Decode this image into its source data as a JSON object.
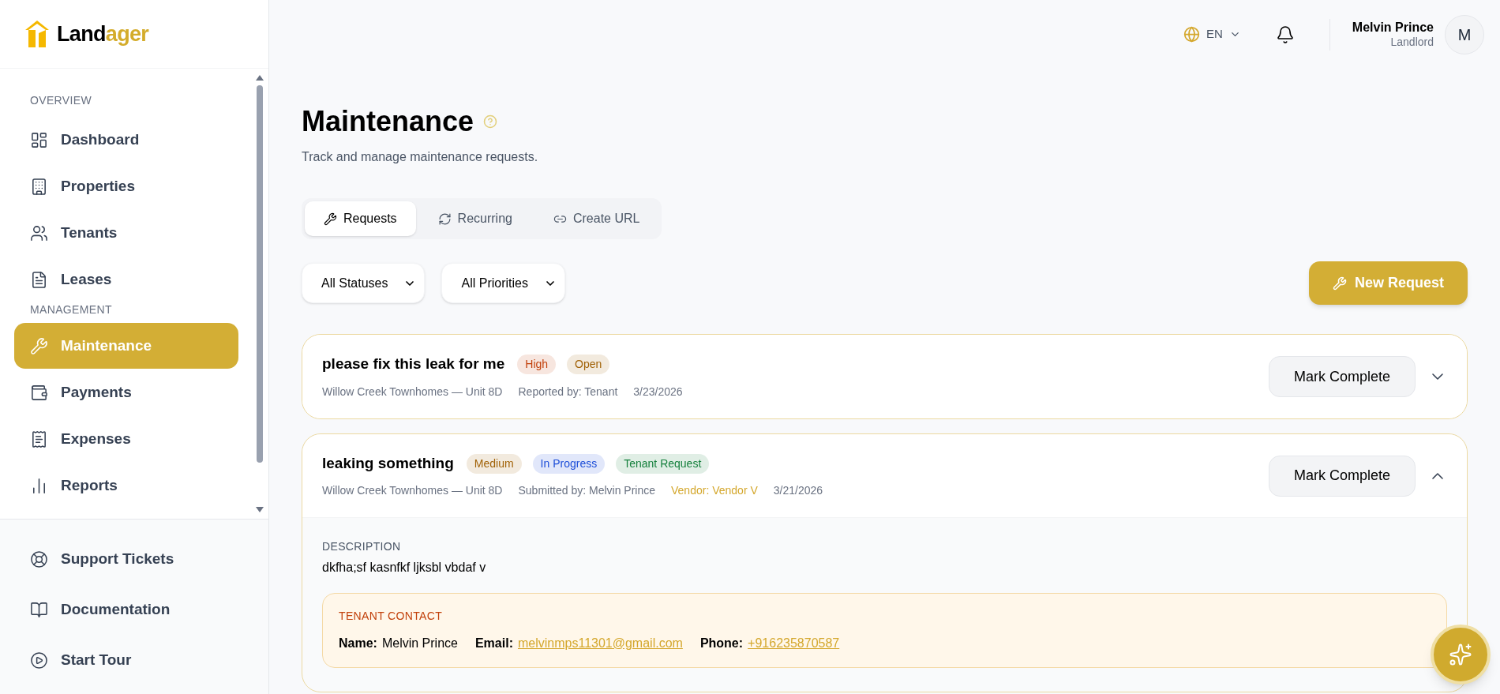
{
  "logo": {
    "text_dark": "Land",
    "text_accent": "ager"
  },
  "sidebar": {
    "sections": [
      {
        "title": "OVERVIEW",
        "items": [
          {
            "label": "Dashboard",
            "selected": false
          },
          {
            "label": "Properties",
            "selected": false
          },
          {
            "label": "Tenants",
            "selected": false
          },
          {
            "label": "Leases",
            "selected": false
          }
        ]
      },
      {
        "title": "MANAGEMENT",
        "items": [
          {
            "label": "Maintenance",
            "selected": true
          },
          {
            "label": "Payments",
            "selected": false
          },
          {
            "label": "Expenses",
            "selected": false
          },
          {
            "label": "Reports",
            "selected": false
          }
        ]
      }
    ],
    "footer_items": [
      {
        "label": "Support Tickets"
      },
      {
        "label": "Documentation"
      },
      {
        "label": "Start Tour"
      }
    ]
  },
  "header": {
    "language": "EN",
    "user_name": "Melvin Prince",
    "user_role": "Landlord",
    "avatar_initial": "M"
  },
  "page": {
    "title": "Maintenance",
    "subtitle": "Track and manage maintenance requests."
  },
  "tabs": [
    {
      "label": "Requests",
      "selected": true
    },
    {
      "label": "Recurring",
      "selected": false
    },
    {
      "label": "Create URL",
      "selected": false
    }
  ],
  "filters": [
    {
      "value": "All Statuses"
    },
    {
      "value": "All Priorities"
    }
  ],
  "new_request_button": "New Request",
  "requests": [
    {
      "title": "please fix this leak for me",
      "badges": [
        {
          "label": "High",
          "color": "#c2410c"
        },
        {
          "label": "Open",
          "color": "#a16207"
        }
      ],
      "meta": [
        {
          "kind": "text",
          "text": "Willow Creek Townhomes — Unit 8D"
        },
        {
          "kind": "text",
          "text": "Reported by: Tenant"
        },
        {
          "kind": "text",
          "text": "3/23/2026"
        }
      ],
      "action": "Mark Complete",
      "expanded": false
    },
    {
      "title": "leaking something",
      "badges": [
        {
          "label": "Medium",
          "color": "#a16207"
        },
        {
          "label": "In Progress",
          "color": "#1d4ed8"
        },
        {
          "label": "Tenant Request",
          "color": "#15803d"
        }
      ],
      "meta": [
        {
          "kind": "text",
          "text": "Willow Creek Townhomes — Unit 8D"
        },
        {
          "kind": "text",
          "text": "Submitted by: Melvin Prince"
        },
        {
          "kind": "vendor",
          "text": "Vendor: Vendor V"
        },
        {
          "kind": "text",
          "text": "3/21/2026"
        }
      ],
      "action": "Mark Complete",
      "expanded": true,
      "details": {
        "description_label": "DESCRIPTION",
        "description": "dkfha;sf kasnfkf ljksbl vbdaf v",
        "contact": {
          "title": "TENANT CONTACT",
          "fields": [
            {
              "label": "Name:",
              "value": "Melvin Prince",
              "kind": "text"
            },
            {
              "label": "Email:",
              "value": "melvinmps11301@gmail.com",
              "kind": "link"
            },
            {
              "label": "Phone:",
              "value": "+916235870587",
              "kind": "link"
            }
          ]
        }
      }
    }
  ]
}
